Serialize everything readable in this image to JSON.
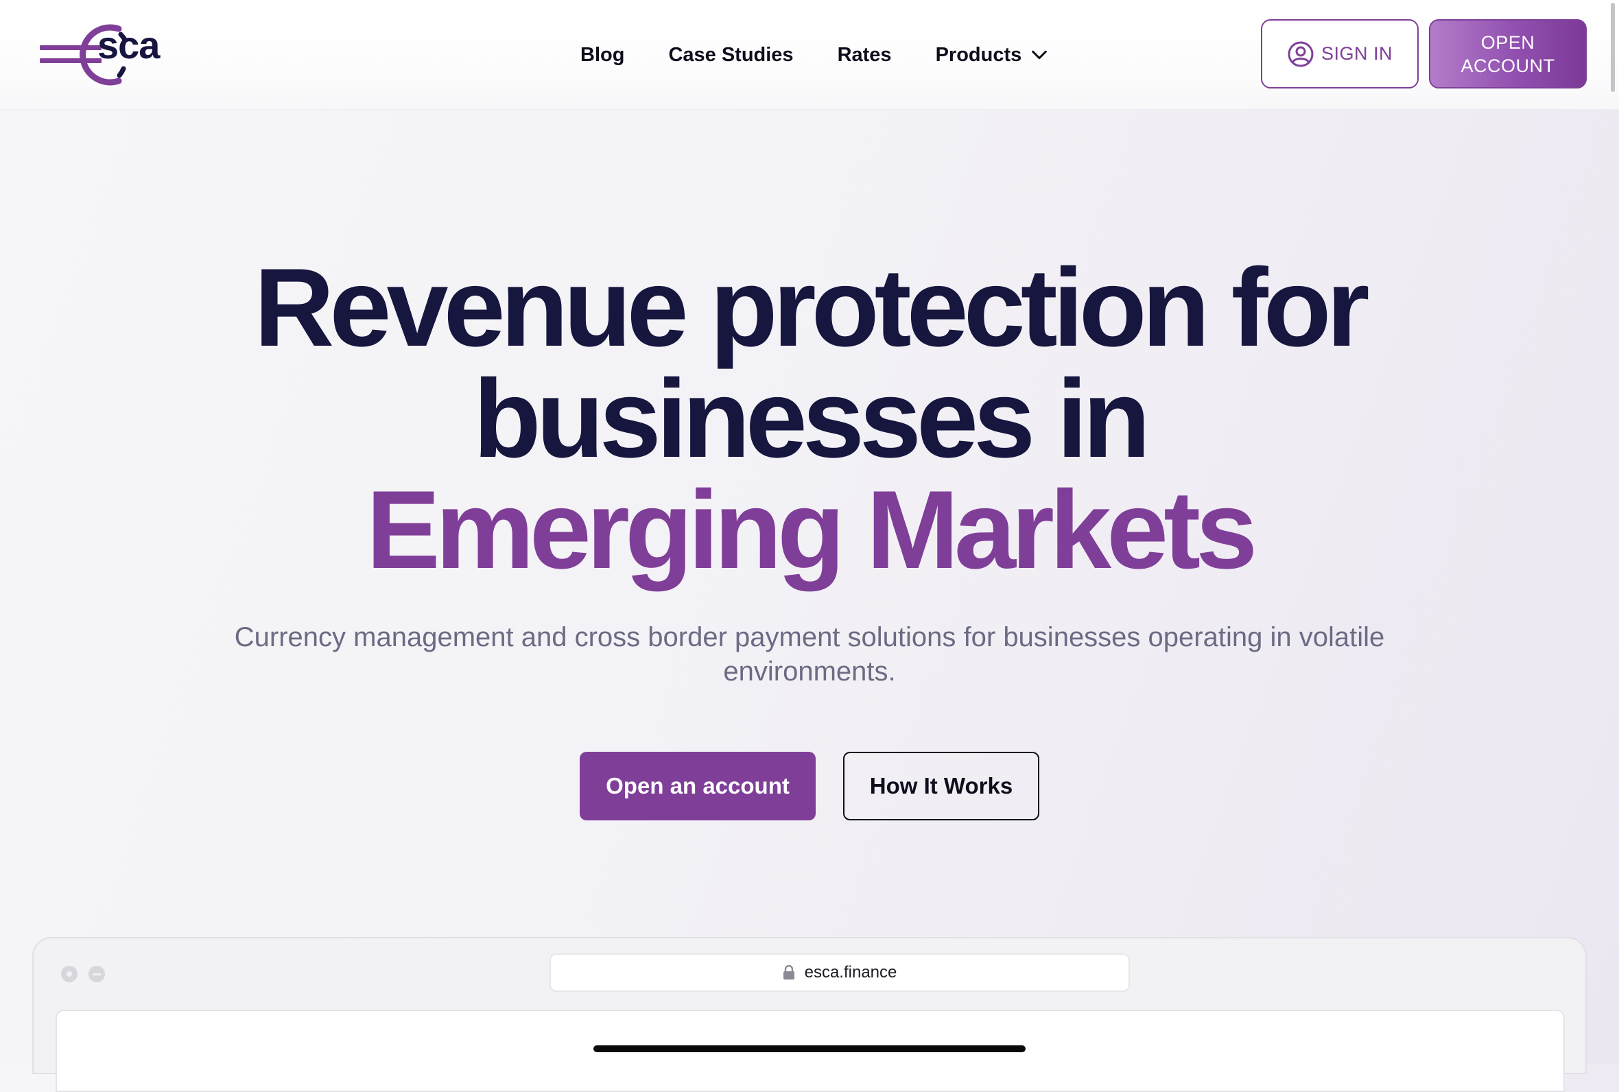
{
  "header": {
    "logo_text": "sca",
    "nav": {
      "blog": "Blog",
      "case_studies": "Case Studies",
      "rates": "Rates",
      "products": "Products"
    },
    "sign_in_label": "SIGN IN",
    "open_account_label": "OPEN ACCOUNT"
  },
  "hero": {
    "title_line1": "Revenue protection for",
    "title_line2": "businesses in",
    "title_accent": "Emerging Markets",
    "subtitle": "Currency management and cross border payment solutions for businesses operating in volatile environments.",
    "cta_primary": "Open an account",
    "cta_secondary": "How It Works"
  },
  "browser_mock": {
    "url": "esca.finance"
  },
  "icons": {
    "logo": "euro-sign-logo",
    "sign_in": "user-circle-icon",
    "products": "chevron-down-icon",
    "url": "lock-icon"
  },
  "colors": {
    "brand_purple": "#7f3f98",
    "navy": "#16163e",
    "subtitle_gray": "#6b6b84"
  }
}
